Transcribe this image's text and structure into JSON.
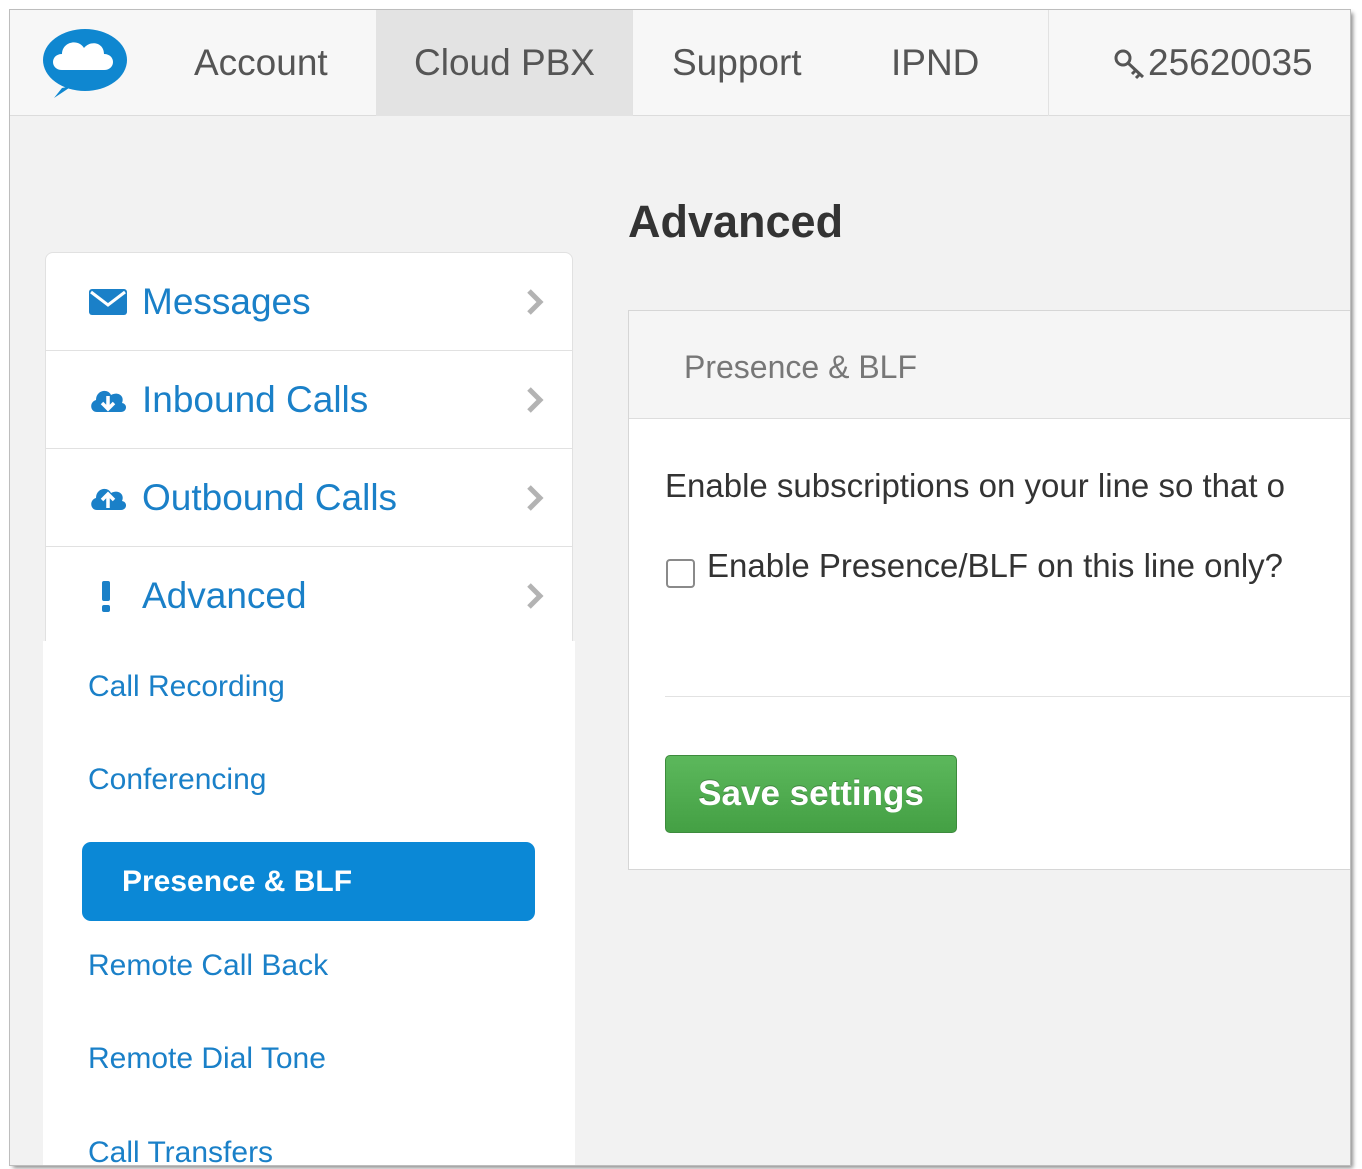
{
  "topnav": {
    "items": [
      {
        "label": "Account"
      },
      {
        "label": "Cloud PBX",
        "active": true
      },
      {
        "label": "Support"
      },
      {
        "label": "IPND"
      }
    ],
    "account_number": "25620035",
    "account_icon": "key-icon"
  },
  "sidebar": {
    "items": [
      {
        "label": "Messages",
        "icon": "envelope-icon"
      },
      {
        "label": "Inbound Calls",
        "icon": "cloud-download-icon"
      },
      {
        "label": "Outbound Calls",
        "icon": "cloud-upload-icon"
      },
      {
        "label": "Advanced",
        "icon": "exclamation-icon",
        "expanded": true
      }
    ],
    "subitems": [
      {
        "label": "Call Recording"
      },
      {
        "label": "Conferencing"
      },
      {
        "label": "Presence & BLF",
        "active": true
      },
      {
        "label": "Remote Call Back"
      },
      {
        "label": "Remote Dial Tone"
      },
      {
        "label": "Call Transfers"
      }
    ]
  },
  "main": {
    "title": "Advanced",
    "panel": {
      "title": "Presence & BLF",
      "description": "Enable subscriptions on your line so that o",
      "checkbox_label": "Enable Presence/BLF on this line only?",
      "checkbox_checked": false,
      "save_label": "Save settings"
    }
  },
  "colors": {
    "link": "#1a80c8",
    "active_bg": "#0b88d6",
    "save_button": "#4cae4c",
    "page_bg": "#f2f2f2"
  }
}
